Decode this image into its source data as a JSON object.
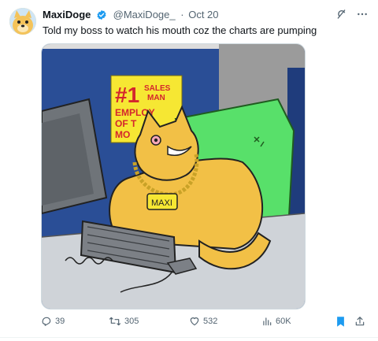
{
  "user": {
    "name": "MaxiDoge",
    "handle": "@MaxiDoge_",
    "separator": "·",
    "date": "Oct 20"
  },
  "tweet": {
    "text": "Told my boss to watch his mouth coz the charts are pumping"
  },
  "media": {
    "sign_line1": "#1",
    "sign_line2": "SALES",
    "sign_line3": "MAN",
    "sign_line4": "EMPLOY",
    "sign_line5": "OF T",
    "sign_line6": "MO",
    "pendant": "MAXI"
  },
  "actions": {
    "replies": "39",
    "reposts": "305",
    "likes": "532",
    "views": "60K"
  },
  "icons": {
    "verified": "verified-badge-icon",
    "grok": "grok-icon",
    "more": "more-icon",
    "reply": "reply-icon",
    "repost": "repost-icon",
    "like": "like-icon",
    "views": "views-icon",
    "bookmark": "bookmark-icon",
    "share": "share-icon"
  },
  "colors": {
    "verified": "#1d9bf0",
    "bookmark": "#1d9bf0",
    "muted": "#536471",
    "wall": "#2a4e96",
    "sign": "#f6e733",
    "doge": "#f2c046",
    "chair": "#58e06a"
  }
}
